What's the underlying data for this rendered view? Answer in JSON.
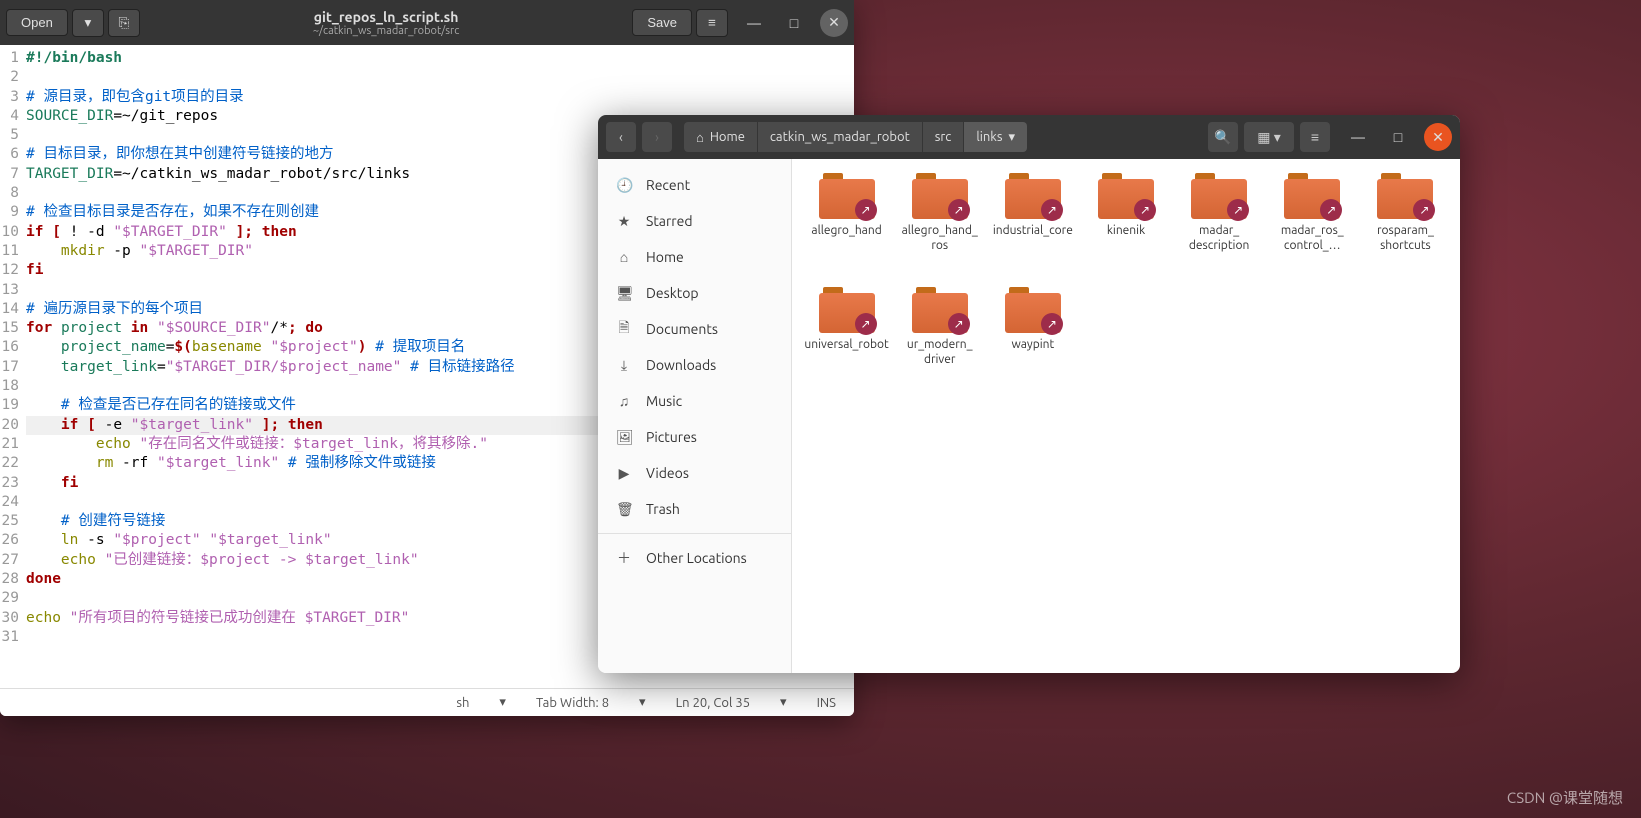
{
  "editor": {
    "open_label": "Open",
    "save_label": "Save",
    "title": "git_repos_ln_script.sh",
    "subtitle": "~/catkin_ws_madar_robot/src",
    "status": {
      "lang": "sh",
      "tab": "Tab Width: 8",
      "pos": "Ln 20, Col 35",
      "ins": "INS"
    },
    "lines": [
      {
        "n": 1,
        "html": "<span class='c-sh'>#!/bin/bash</span>"
      },
      {
        "n": 2,
        "html": ""
      },
      {
        "n": 3,
        "html": "<span class='c-comment'># 源目录，即包含git项目的目录</span>"
      },
      {
        "n": 4,
        "html": "<span class='c-var'>SOURCE_DIR</span>=~/git_repos"
      },
      {
        "n": 5,
        "html": ""
      },
      {
        "n": 6,
        "html": "<span class='c-comment'># 目标目录，即你想在其中创建符号链接的地方</span>"
      },
      {
        "n": 7,
        "html": "<span class='c-var'>TARGET_DIR</span>=~/catkin_ws_madar_robot/src/links"
      },
      {
        "n": 8,
        "html": ""
      },
      {
        "n": 9,
        "html": "<span class='c-comment'># 检查目标目录是否存在，如果不存在则创建</span>"
      },
      {
        "n": 10,
        "html": "<span class='c-kw'>if</span> <span class='c-kw'>[</span> ! -d <span class='c-str'>\"$TARGET_DIR\"</span> <span class='c-kw'>]; then</span>"
      },
      {
        "n": 11,
        "html": "    <span class='c-cmd'>mkdir</span> -p <span class='c-str'>\"$TARGET_DIR\"</span>"
      },
      {
        "n": 12,
        "html": "<span class='c-kw'>fi</span>"
      },
      {
        "n": 13,
        "html": ""
      },
      {
        "n": 14,
        "html": "<span class='c-comment'># 遍历源目录下的每个项目</span>"
      },
      {
        "n": 15,
        "html": "<span class='c-kw'>for</span> <span class='c-var'>project</span> <span class='c-kw'>in</span> <span class='c-str'>\"$SOURCE_DIR\"</span>/*<span class='c-kw'>; do</span>"
      },
      {
        "n": 16,
        "html": "    <span class='c-var'>project_name</span>=<span class='c-kw'>$(</span><span class='c-cmd'>basename</span> <span class='c-str'>\"$project\"</span><span class='c-kw'>)</span> <span class='c-comment'># 提取项目名</span>"
      },
      {
        "n": 17,
        "html": "    <span class='c-var'>target_link</span>=<span class='c-str'>\"$TARGET_DIR/$project_name\"</span> <span class='c-comment'># 目标链接路径</span>"
      },
      {
        "n": 18,
        "html": ""
      },
      {
        "n": 19,
        "html": "    <span class='c-comment'># 检查是否已存在同名的链接或文件</span>"
      },
      {
        "n": 20,
        "html": "    <span class='c-kw'>if</span> <span class='c-kw'>[</span> -e <span class='c-str'>\"$target_link\"</span> <span class='c-kw'>]; then</span>",
        "hl": true
      },
      {
        "n": 21,
        "html": "        <span class='c-cmd'>echo</span> <span class='c-str'>\"存在同名文件或链接：$target_link，将其移除.\"</span>"
      },
      {
        "n": 22,
        "html": "        <span class='c-cmd'>rm</span> -rf <span class='c-str'>\"$target_link\"</span> <span class='c-comment'># 强制移除文件或链接</span>"
      },
      {
        "n": 23,
        "html": "    <span class='c-kw'>fi</span>"
      },
      {
        "n": 24,
        "html": ""
      },
      {
        "n": 25,
        "html": "    <span class='c-comment'># 创建符号链接</span>"
      },
      {
        "n": 26,
        "html": "    <span class='c-cmd'>ln</span> -s <span class='c-str'>\"$project\"</span> <span class='c-str'>\"$target_link\"</span>"
      },
      {
        "n": 27,
        "html": "    <span class='c-cmd'>echo</span> <span class='c-str'>\"已创建链接：$project -&gt; $target_link\"</span>"
      },
      {
        "n": 28,
        "html": "<span class='c-kw'>done</span>"
      },
      {
        "n": 29,
        "html": ""
      },
      {
        "n": 30,
        "html": "<span class='c-cmd'>echo</span> <span class='c-str'>\"所有项目的符号链接已成功创建在 $TARGET_DIR\"</span>"
      },
      {
        "n": 31,
        "html": ""
      }
    ]
  },
  "files": {
    "path": [
      {
        "icon": "⌂",
        "label": "Home"
      },
      {
        "label": "catkin_ws_madar_robot"
      },
      {
        "label": "src"
      },
      {
        "label": "links",
        "active": true,
        "dd": true
      }
    ],
    "sidebar": [
      {
        "icon": "🕘",
        "label": "Recent"
      },
      {
        "icon": "★",
        "label": "Starred"
      },
      {
        "icon": "⌂",
        "label": "Home"
      },
      {
        "icon": "🖥",
        "label": "Desktop"
      },
      {
        "icon": "🗎",
        "label": "Documents"
      },
      {
        "icon": "⤓",
        "label": "Downloads"
      },
      {
        "icon": "♫",
        "label": "Music"
      },
      {
        "icon": "🖼",
        "label": "Pictures"
      },
      {
        "icon": "▶",
        "label": "Videos"
      },
      {
        "icon": "🗑",
        "label": "Trash"
      },
      {
        "sep": true
      },
      {
        "icon": "＋",
        "label": "Other Locations"
      }
    ],
    "folders": [
      "allegro_hand",
      "allegro_hand_ros",
      "industrial_core",
      "kinenik",
      "madar_description",
      "madar_ros_control_…",
      "rosparam_shortcuts",
      "universal_robot",
      "ur_modern_driver",
      "waypint"
    ]
  },
  "watermark": "CSDN @课堂随想"
}
